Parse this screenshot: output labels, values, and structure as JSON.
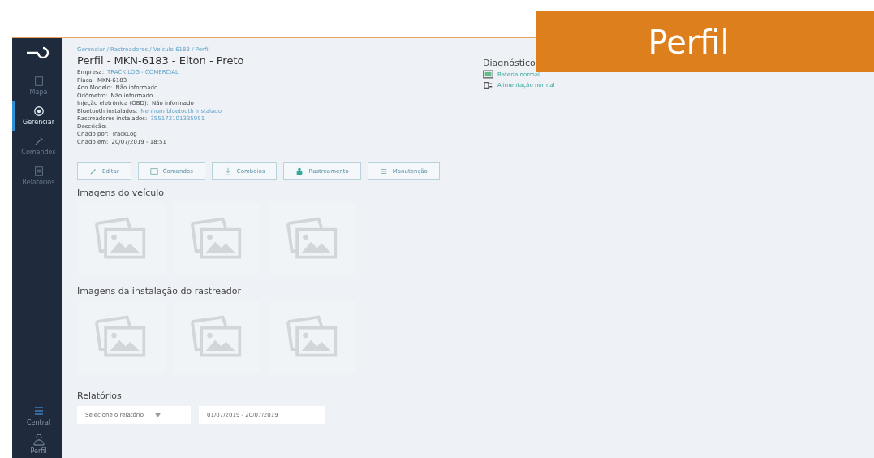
{
  "banner": {
    "title": "Perfil"
  },
  "sidebar": {
    "items": [
      {
        "label": "Mapa",
        "selected": false
      },
      {
        "label": "Gerenciar",
        "selected": true
      },
      {
        "label": "Comandos",
        "selected": false
      },
      {
        "label": "Relatórios",
        "selected": false
      }
    ],
    "bottom_items": [
      {
        "label": "Central"
      },
      {
        "label": "Perfil"
      }
    ]
  },
  "breadcrumb": "Gerenciar / Rastreadores / Veículo 6183 / Perfil",
  "title": "Perfil - MKN-6183 - Elton - Preto",
  "fields": [
    {
      "label": "Empresa:",
      "value": "TRACK LOG - COMERCIAL",
      "link": true
    },
    {
      "label": "Placa:",
      "value": "MKN-6183",
      "link": false
    },
    {
      "label": "Ano Modelo:",
      "value": "Não informado",
      "link": false
    },
    {
      "label": "Odômetro:",
      "value": "Não informado",
      "link": false
    },
    {
      "label": "Injeção eletrônica (OBD):",
      "value": "Não informado",
      "link": false
    },
    {
      "label": "Bluetooth instalados:",
      "value": "Nenhum bluetooth instalado",
      "link": true
    },
    {
      "label": "Rastreadores instalados:",
      "value": "355172101335951",
      "link": true
    },
    {
      "label": "Descrição:"
    },
    {
      "label": "Criado por:",
      "value": "TrackLog",
      "link": false
    },
    {
      "label": "Criado em:",
      "value": "20/07/2019 - 18:51",
      "link": false
    }
  ],
  "diagnostics": {
    "title": "Diagnóstico",
    "items": [
      {
        "label": "Bateria normal"
      },
      {
        "label": "Alimentação normal"
      }
    ]
  },
  "actions": [
    {
      "label": "Editar"
    },
    {
      "label": "Comandos"
    },
    {
      "label": "Comboios"
    },
    {
      "label": "Rastreamento"
    },
    {
      "label": "Manutenção"
    }
  ],
  "galleries": [
    {
      "title": "Imagens do veículo"
    },
    {
      "title": "Imagens da instalação do rastreador"
    }
  ],
  "reports": {
    "title": "Relatórios",
    "controls": [
      {
        "kind": "select",
        "value": "Selecione o relatório"
      },
      {
        "kind": "field",
        "value": "01/07/2019 - 20/07/2019"
      }
    ]
  }
}
